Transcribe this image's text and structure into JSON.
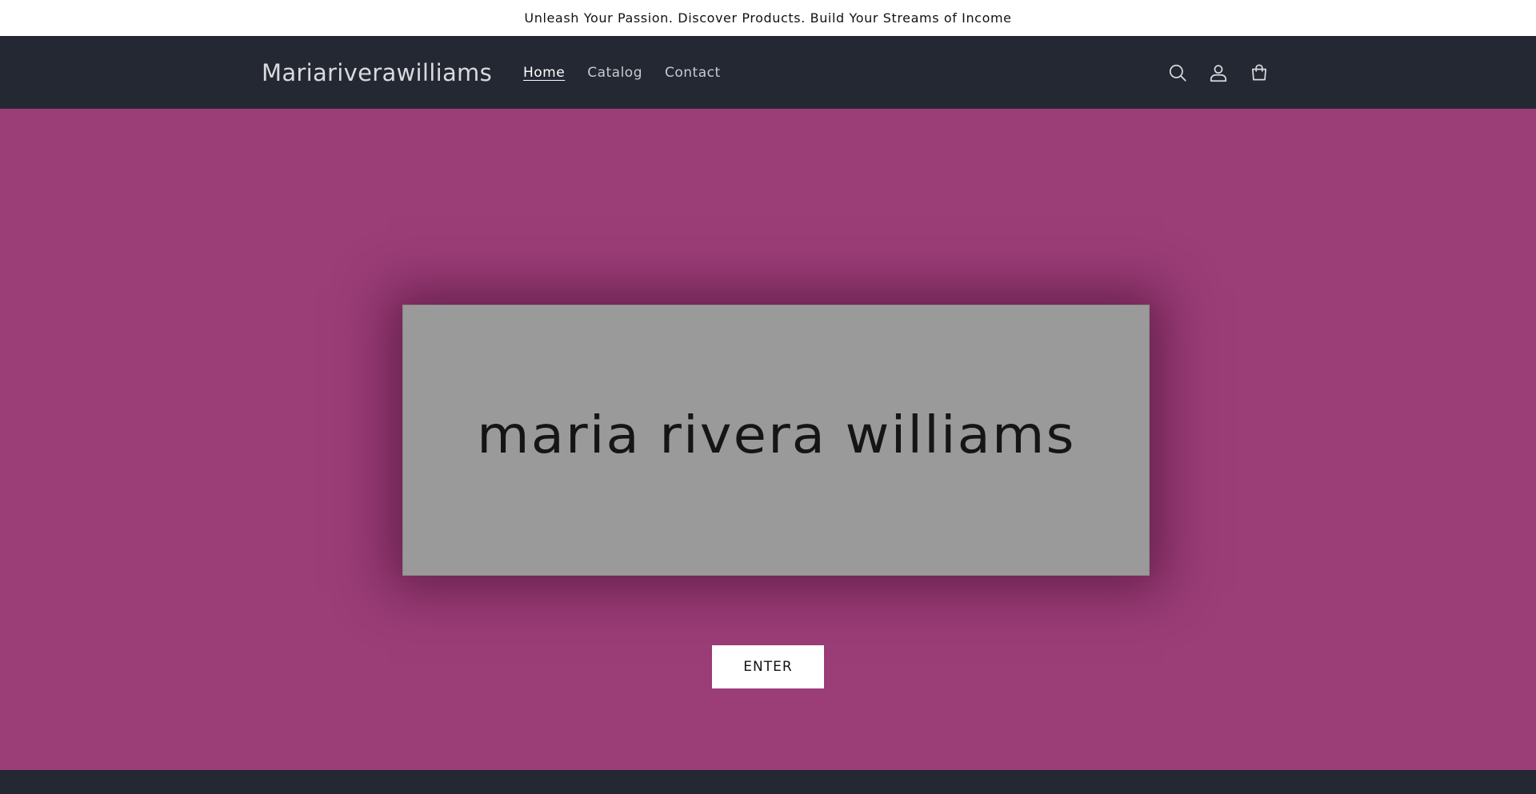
{
  "announcement": {
    "text": "Unleash Your Passion. Discover Products. Build Your Streams of Income"
  },
  "header": {
    "logo": "Mariariverawilliams",
    "nav": [
      {
        "label": "Home"
      },
      {
        "label": "Catalog"
      },
      {
        "label": "Contact"
      }
    ],
    "icons": [
      "search-icon",
      "account-icon",
      "cart-icon"
    ]
  },
  "hero": {
    "banner_text": "maria rivera williams",
    "button_label": "ENTER"
  },
  "colors": {
    "header_bg": "#242833",
    "hero_bg": "#9b3d77",
    "banner_bg": "#9a9a9a",
    "announcement_bg": "#ffffff"
  }
}
